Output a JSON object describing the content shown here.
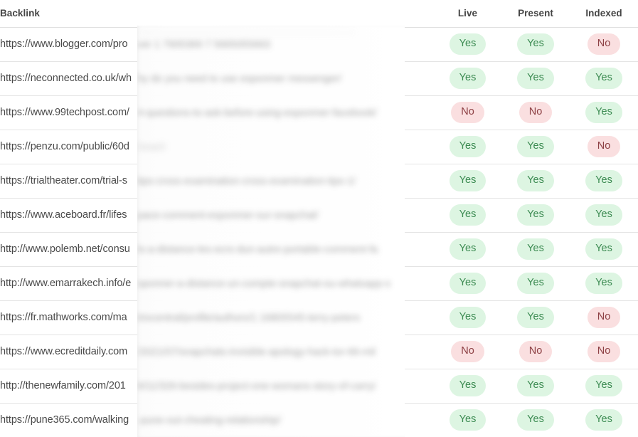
{
  "table": {
    "columns": {
      "backlink": "Backlink",
      "live": "Live",
      "present": "Present",
      "indexed": "Indexed"
    },
    "rows": [
      {
        "backlink": "https://www.blogger.com/pro",
        "obscured_text": "ver 1 7905369 7 5665055663",
        "live": "Yes",
        "present": "Yes",
        "indexed": "No"
      },
      {
        "backlink": "https://neconnected.co.uk/wh",
        "obscured_text": "hy do you need to use esponmer messenger/",
        "live": "Yes",
        "present": "Yes",
        "indexed": "Yes"
      },
      {
        "backlink": "https://www.99techpost.com/",
        "obscured_text": "4-questions-to-ask-before-using-esponmer-facebook/",
        "live": "No",
        "present": "No",
        "indexed": "Yes"
      },
      {
        "backlink": "https://penzu.com/public/60d",
        "obscured_text": "0eae0",
        "live": "Yes",
        "present": "Yes",
        "indexed": "No"
      },
      {
        "backlink": "https://trialtheater.com/trial-s",
        "obscured_text": "tips-cross-examination-cross-examination-tips-1/",
        "live": "Yes",
        "present": "Yes",
        "indexed": "Yes"
      },
      {
        "backlink": "https://www.aceboard.fr/lifes",
        "obscured_text": "pace-comment-esponmer-sur-snapchat/",
        "live": "Yes",
        "present": "Yes",
        "indexed": "Yes"
      },
      {
        "backlink": "http://www.polemb.net/consu",
        "obscured_text": "ls-a-distance-les-ecrs-dun-autre-portable-comment-fa",
        "live": "Yes",
        "present": "Yes",
        "indexed": "Yes"
      },
      {
        "backlink": "http://www.emarrakech.info/e",
        "obscured_text": "sponner-a-distance-un-compte-snapchat-ou-whatsapp-s",
        "live": "Yes",
        "present": "Yes",
        "indexed": "Yes"
      },
      {
        "backlink": "https://fr.mathworks.com/ma",
        "obscured_text": "trixcentral/profile/authors/1 16805545-terry-peters",
        "live": "Yes",
        "present": "Yes",
        "indexed": "No"
      },
      {
        "backlink": "https://www.ecreditdaily.com",
        "obscured_text": "/2021/07/snapchats-invisible-apology-hack-tor-66-mil",
        "live": "No",
        "present": "No",
        "indexed": "No"
      },
      {
        "backlink": "http://thenewfamily.com/201",
        "obscured_text": "6/11/326-besides-project-one-womans-story-of-carryi",
        "live": "Yes",
        "present": "Yes",
        "indexed": "Yes"
      },
      {
        "backlink": "https://pune365.com/walking",
        "obscured_text": "-pune-out-cheating-relationship/",
        "live": "Yes",
        "present": "Yes",
        "indexed": "Yes"
      }
    ]
  },
  "colors": {
    "pill_yes_bg": "#ddf5e2",
    "pill_yes_text": "#3c8b52",
    "pill_no_bg": "#fadfe0",
    "pill_no_text": "#8d4044",
    "header_text": "#454545",
    "row_text": "#4a4a4a",
    "row_border": "#e4e4e4"
  },
  "overlay": {
    "present": true,
    "description": "blurred-panel"
  }
}
